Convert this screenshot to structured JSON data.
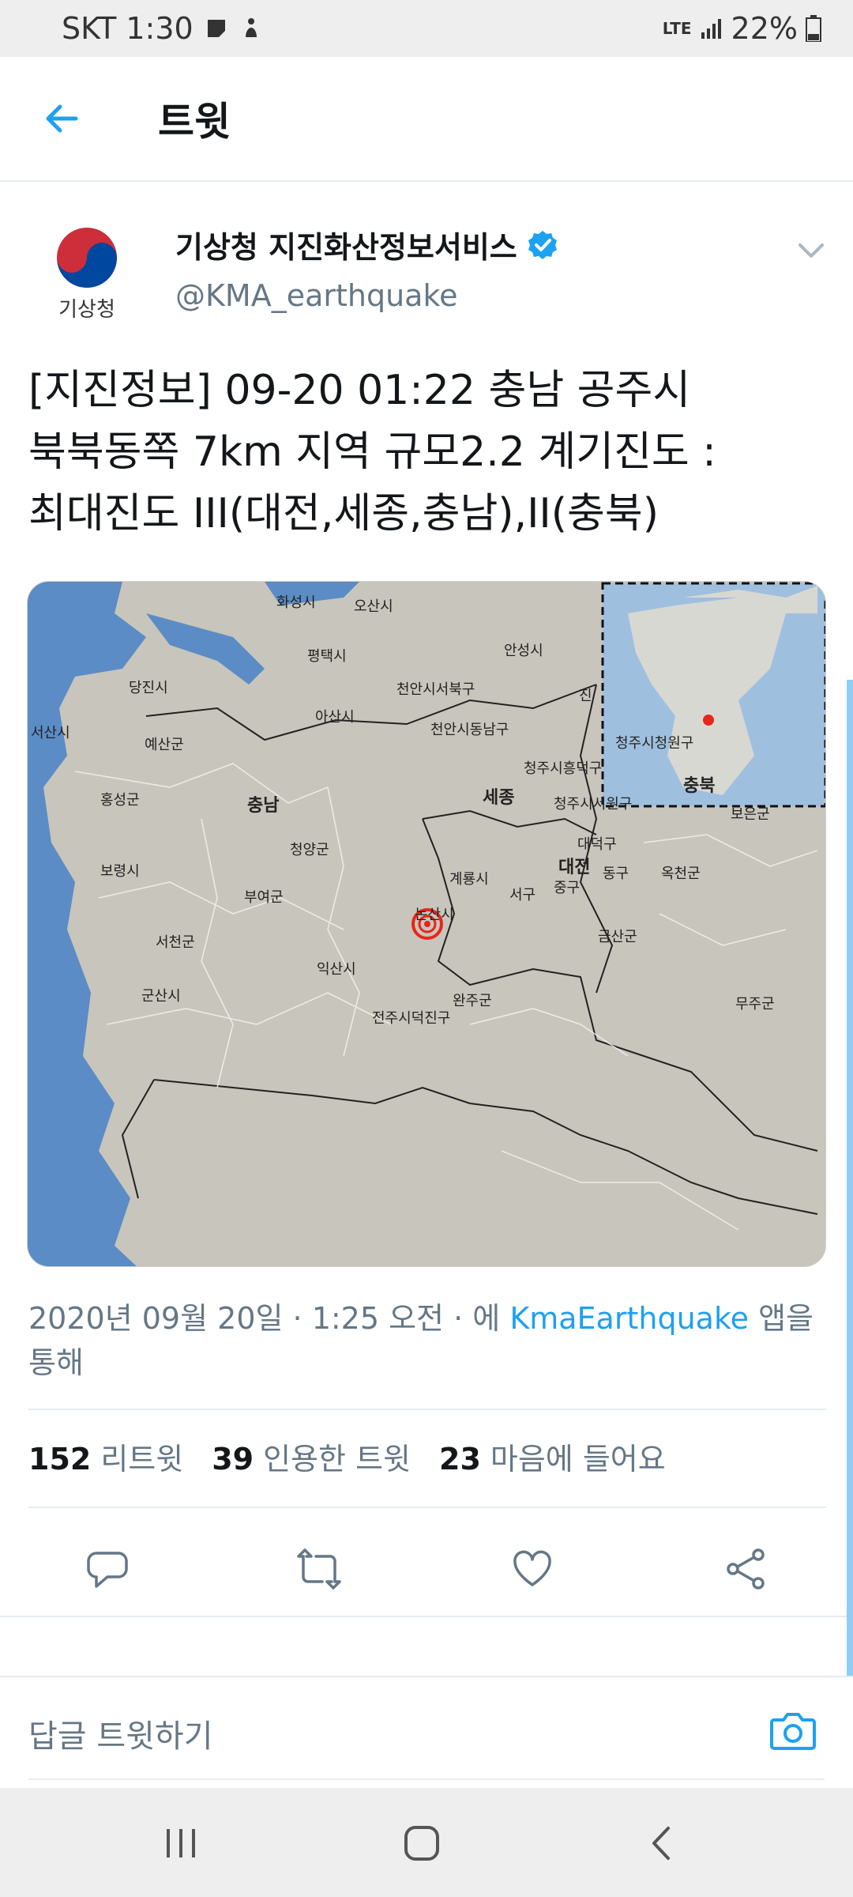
{
  "status_bar": {
    "carrier_time": "SKT 1:30",
    "network": "LTE",
    "battery": "22%"
  },
  "header": {
    "title": "트윗"
  },
  "author": {
    "name": "기상청 지진화산정보서비스",
    "handle": "@KMA_earthquake",
    "avatar_text": "기상청",
    "verified": true
  },
  "tweet": {
    "line1": "[지진정보] 09-20 01:22 충남 공주시",
    "line2": "북북동쪽 7km 지역 규모2.2 계기진도 :",
    "line3": "최대진도 III(대전,세종,충남),II(충북)"
  },
  "map": {
    "labels": [
      "화성시",
      "오산시",
      "평택시",
      "안성시",
      "당진시",
      "천안시서북구",
      "아산시",
      "천안시동남구",
      "서산시",
      "예산군",
      "청주시청원구",
      "청주시흥덕구",
      "홍성군",
      "충남",
      "세종",
      "청주시서원구",
      "충북",
      "보은군",
      "청양군",
      "대덕구",
      "대전",
      "동구",
      "옥천군",
      "보령시",
      "계룡시",
      "서구",
      "중구",
      "부여군",
      "논산시",
      "서천군",
      "금산군",
      "익산시",
      "군산시",
      "완주군",
      "무주군",
      "전주시덕진구",
      "진"
    ]
  },
  "meta": {
    "datetime": "2020년 09월 20일 · 1:25 오전 · 에",
    "source": "KmaEarthquake",
    "suffix_line1": "앱을",
    "suffix_line2": "통해"
  },
  "stats": {
    "retweets_count": "152",
    "retweets_label": "리트윗",
    "quotes_count": "39",
    "quotes_label": "인용한 트윗",
    "likes_count": "23",
    "likes_label": "마음에 들어요"
  },
  "reply": {
    "placeholder": "답글 트윗하기"
  },
  "colors": {
    "accent": "#1da1f2",
    "muted": "#657786",
    "text": "#14171a"
  }
}
